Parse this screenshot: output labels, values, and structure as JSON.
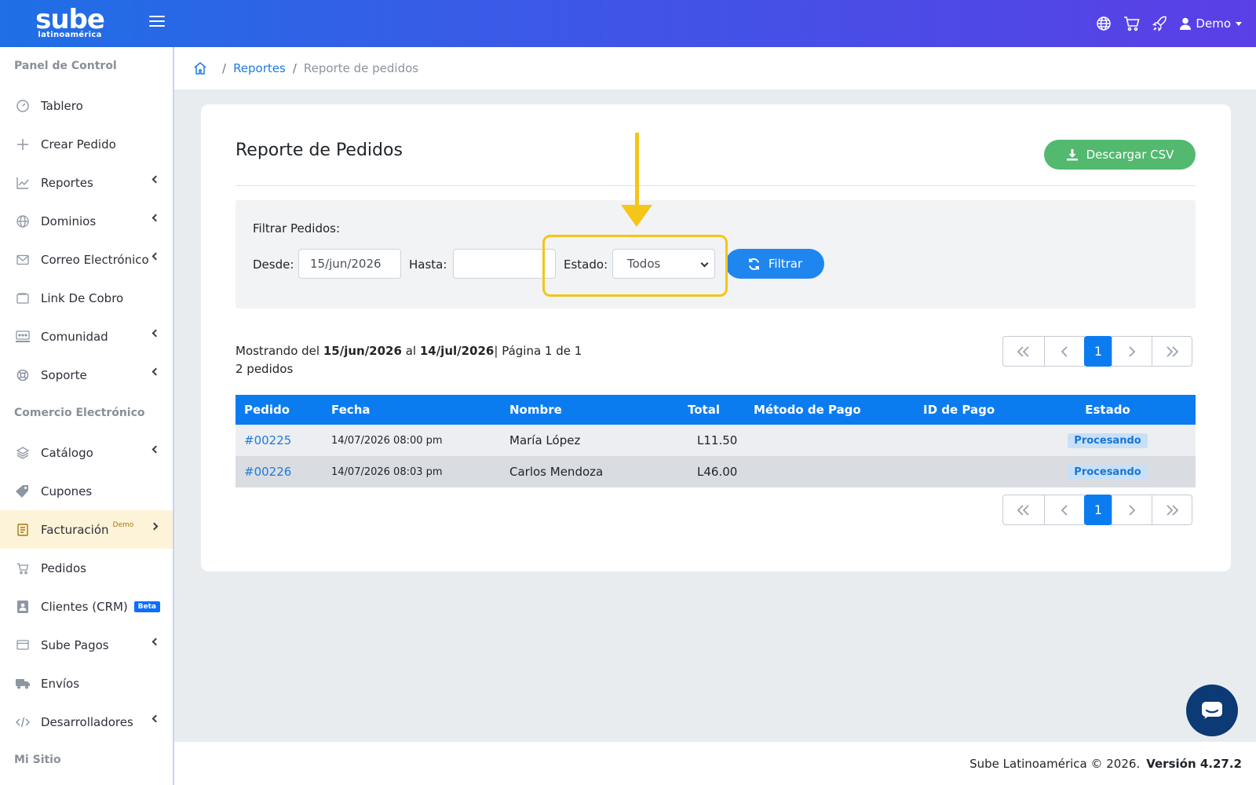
{
  "brand": {
    "name": "sube",
    "sub": "latinoamérica"
  },
  "topbar": {
    "user_label": "Demo"
  },
  "sidebar": {
    "section1": "Panel de Control",
    "section2": "Comercio Electrónico",
    "section3": "Mi Sitio",
    "items": [
      {
        "label": "Tablero",
        "icon": "dashboard-icon"
      },
      {
        "label": "Crear Pedido",
        "icon": "plus-icon"
      },
      {
        "label": "Reportes",
        "icon": "chart-line-icon"
      },
      {
        "label": "Dominios",
        "icon": "globe-icon"
      },
      {
        "label": "Correo Electrónico",
        "icon": "mail-icon"
      },
      {
        "label": "Link De Cobro",
        "icon": "wallet-icon"
      },
      {
        "label": "Comunidad",
        "icon": "community-icon"
      },
      {
        "label": "Soporte",
        "icon": "lifebuoy-icon"
      },
      {
        "label": "Catálogo",
        "icon": "layers-icon"
      },
      {
        "label": "Cupones",
        "icon": "tag-icon"
      },
      {
        "label": "Facturación",
        "icon": "invoice-icon",
        "sup": "Demo"
      },
      {
        "label": "Pedidos",
        "icon": "cart-icon"
      },
      {
        "label": "Clientes (CRM)",
        "icon": "contact-icon",
        "badge": "Beta"
      },
      {
        "label": "Sube Pagos",
        "icon": "card-icon"
      },
      {
        "label": "Envíos",
        "icon": "truck-icon"
      },
      {
        "label": "Desarrolladores",
        "icon": "code-icon"
      }
    ]
  },
  "breadcrumb": {
    "level1": "Reportes",
    "current": "Reporte de pedidos"
  },
  "main": {
    "title": "Reporte de Pedidos",
    "download_label": "Descargar CSV",
    "filter": {
      "title": "Filtrar Pedidos:",
      "from_label": "Desde:",
      "from_value": "15/jun/2026",
      "to_label": "Hasta:",
      "to_value": "",
      "status_label": "Estado:",
      "status_value": "Todos",
      "button_label": "Filtrar"
    },
    "summary": {
      "prefix": "Mostrando del ",
      "from": "15/jun/2026",
      "mid": " al ",
      "to": "14/jul/2026",
      "page": "| Página 1 de 1",
      "count": "2 pedidos"
    },
    "pager": {
      "current": "1"
    },
    "table": {
      "headers": [
        "Pedido",
        "Fecha",
        "Nombre",
        "Total",
        "Método de Pago",
        "ID de Pago",
        "Estado"
      ],
      "rows": [
        {
          "pedido": "#00225",
          "fecha": "14/07/2026 08:00 pm",
          "nombre": "María López",
          "total": "L11.50",
          "metodo": "",
          "id_pago": "",
          "estado": "Procesando"
        },
        {
          "pedido": "#00226",
          "fecha": "14/07/2026 08:03 pm",
          "nombre": "Carlos Mendoza",
          "total": "L46.00",
          "metodo": "",
          "id_pago": "",
          "estado": "Procesando"
        }
      ]
    }
  },
  "footer": {
    "copyright": "Sube Latinoamérica © 2026.",
    "version": "Versión 4.27.2"
  },
  "colors": {
    "accent": "#0b7cf0",
    "success": "#52b96f",
    "highlight": "#f5c518"
  }
}
